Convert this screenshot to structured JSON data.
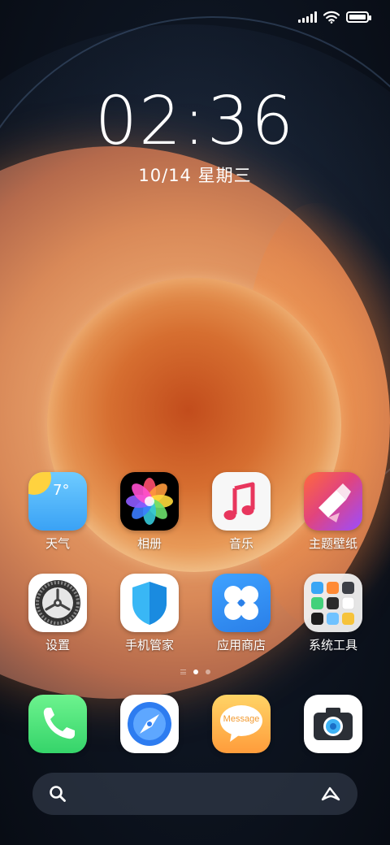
{
  "status_bar": {
    "signal_icon": "signal-icon",
    "wifi_icon": "wifi-icon",
    "battery_icon": "battery-icon",
    "battery_level": 1.0
  },
  "lockscreen_widget": {
    "time": "02:36",
    "date": "10/14 星期三"
  },
  "apps_row1": [
    {
      "label": "天气",
      "icon": "weather-icon",
      "temp": "7°"
    },
    {
      "label": "相册",
      "icon": "photos-icon"
    },
    {
      "label": "音乐",
      "icon": "music-icon"
    },
    {
      "label": "主题壁纸",
      "icon": "theme-icon"
    }
  ],
  "apps_row2": [
    {
      "label": "设置",
      "icon": "settings-icon"
    },
    {
      "label": "手机管家",
      "icon": "security-icon"
    },
    {
      "label": "应用商店",
      "icon": "app-store-icon"
    },
    {
      "label": "系统工具",
      "icon": "folder-icon"
    }
  ],
  "page_indicator": {
    "pages": 2,
    "current": 1
  },
  "dock": [
    {
      "icon": "phone-icon"
    },
    {
      "icon": "browser-icon"
    },
    {
      "icon": "message-icon",
      "text": "Message"
    },
    {
      "icon": "camera-icon"
    }
  ],
  "search": {
    "search_icon": "search-icon",
    "assistant_icon": "assistant-icon"
  },
  "colors": {
    "weather_bg": "#3aa2f5",
    "music_note": "#e8365d",
    "store_bg": "#2a7fe8",
    "phone_bg": "#35d46a",
    "message_bg": "#ff9c3b"
  }
}
